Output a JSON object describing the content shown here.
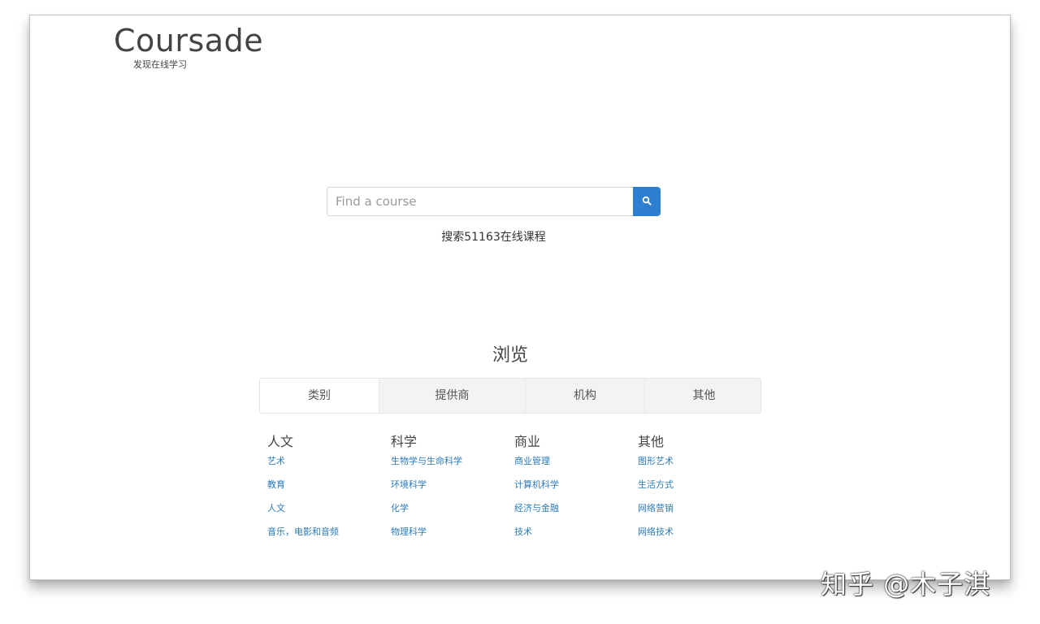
{
  "header": {
    "logo": "Coursade",
    "tagline": "发现在线学习"
  },
  "search": {
    "placeholder": "Find a course",
    "value": "",
    "button_icon": "search-icon",
    "count_text": "搜索51163在线课程"
  },
  "browse": {
    "title": "浏览",
    "tabs": [
      {
        "label": "类别",
        "active": true
      },
      {
        "label": "提供商",
        "active": false
      },
      {
        "label": "机构",
        "active": false
      },
      {
        "label": "其他",
        "active": false
      }
    ],
    "columns": [
      {
        "heading": "人文",
        "links": [
          "艺术",
          "教育",
          "人文",
          "音乐，电影和音频"
        ]
      },
      {
        "heading": "科学",
        "links": [
          "生物学与生命科学",
          "环境科学",
          "化学",
          "物理科学"
        ]
      },
      {
        "heading": "商业",
        "links": [
          "商业管理",
          "计算机科学",
          "经济与金融",
          "技术"
        ]
      },
      {
        "heading": "其他",
        "links": [
          "图形艺术",
          "生活方式",
          "网络营销",
          "网络技术"
        ]
      }
    ]
  },
  "watermark": "知乎 @木子淇",
  "colors": {
    "accent": "#2e7fd0",
    "link": "#2a7ab8",
    "text": "#444444"
  }
}
